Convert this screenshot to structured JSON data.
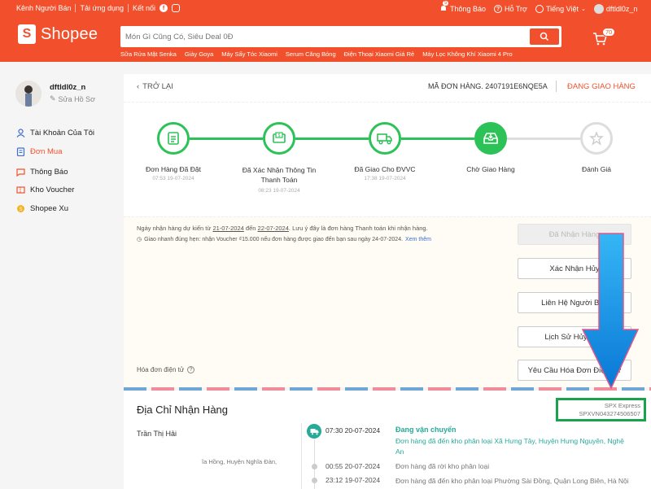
{
  "topbar": {
    "seller_channel": "Kênh Người Bán",
    "download_app": "Tải ứng dụng",
    "connect": "Kết nối",
    "notifications": "Thông Báo",
    "notif_count": "5",
    "help": "Hỗ Trợ",
    "language": "Tiếng Việt",
    "username": "dftldl0z_n"
  },
  "header": {
    "logo": "Shopee",
    "search_placeholder": "Món Gì Cũng Có, Siêu Deal 0Đ",
    "cart_count": "70",
    "suggestions": [
      "Sữa Rửa Mặt Senka",
      "Giày Goya",
      "Máy Sấy Tóc Xiaomi",
      "Serum Căng Bóng",
      "Điện Thoại Xiaomi Giá Rẻ",
      "Máy Lọc Không Khí Xiaomi 4 Pro"
    ]
  },
  "sidebar": {
    "username": "dftldl0z_n",
    "edit_profile": "Sửa Hồ Sơ",
    "items": [
      {
        "label": "Tài Khoản Của Tôi",
        "icon": "user-icon"
      },
      {
        "label": "Đơn Mua",
        "icon": "clipboard-icon"
      },
      {
        "label": "Thông Báo",
        "icon": "bell-icon"
      },
      {
        "label": "Kho Voucher",
        "icon": "voucher-icon"
      },
      {
        "label": "Shopee Xu",
        "icon": "coin-icon"
      }
    ]
  },
  "order": {
    "back": "TRỞ LẠI",
    "order_id": "MÃ ĐƠN HÀNG. 2407191E6NQE5A",
    "status": "ĐANG GIAO HÀNG",
    "steps": [
      {
        "label": "Đơn Hàng Đã Đặt",
        "time": "07:53 19-07-2024"
      },
      {
        "label": "Đã Xác Nhận Thông Tin Thanh Toán",
        "time": "08:23 19-07-2024"
      },
      {
        "label": "Đã Giao Cho ĐVVC",
        "time": "17:38 19-07-2024"
      },
      {
        "label": "Chờ Giao Hàng",
        "time": ""
      },
      {
        "label": "Đánh Giá",
        "time": ""
      }
    ],
    "notice_prefix": "Ngày nhận hàng dự kiến từ",
    "date_from": "21-07-2024",
    "notice_mid": "đến",
    "date_to": "22-07-2024",
    "notice_suffix": ". Lưu ý đây là đơn hàng Thanh toán khi nhận hàng.",
    "fast_delivery": "Giao nhanh đúng hẹn: nhận Voucher ₫15.000 nếu đơn hàng được giao đến bạn sau ngày 24-07-2024.",
    "see_more": "Xem thêm",
    "received_button": "Đã Nhận Hàng",
    "cancel_button": "Xác Nhận Hủy",
    "contact_button": "Liên Hệ Người Bán",
    "history_button": "Lịch Sử Hủy Đơn",
    "invoice_label": "Hóa đơn điện tử",
    "invoice_button": "Yêu Cầu Hóa Đơn Điện Tử"
  },
  "address": {
    "title": "Địa Chỉ Nhận Hàng",
    "carrier": "SPX Express",
    "tracking": "SPXVN043274506507",
    "name": "Trần Thị Hải",
    "address_line": "ĩa Hồng, Huyện Nghĩa Đàn,",
    "tracking_events": [
      {
        "time": "07:30 20-07-2024",
        "title": "Đang vận chuyển",
        "desc": "Đơn hàng đã đến kho phân loại Xã Hưng Tây, Huyện Hưng Nguyên, Nghệ An"
      },
      {
        "time": "00:55 20-07-2024",
        "title": "",
        "desc": "Đơn hàng đã rời kho phân loại"
      },
      {
        "time": "23:12 19-07-2024",
        "title": "",
        "desc": "Đơn hàng đã đến kho phân loại Phường Sài Đồng, Quận Long Biên, Hà Nội"
      }
    ]
  },
  "colors": {
    "brand": "#f2502c",
    "success": "#2dc258",
    "arrow": "#0f8fe0",
    "highlight_box": "#1aa34a"
  }
}
